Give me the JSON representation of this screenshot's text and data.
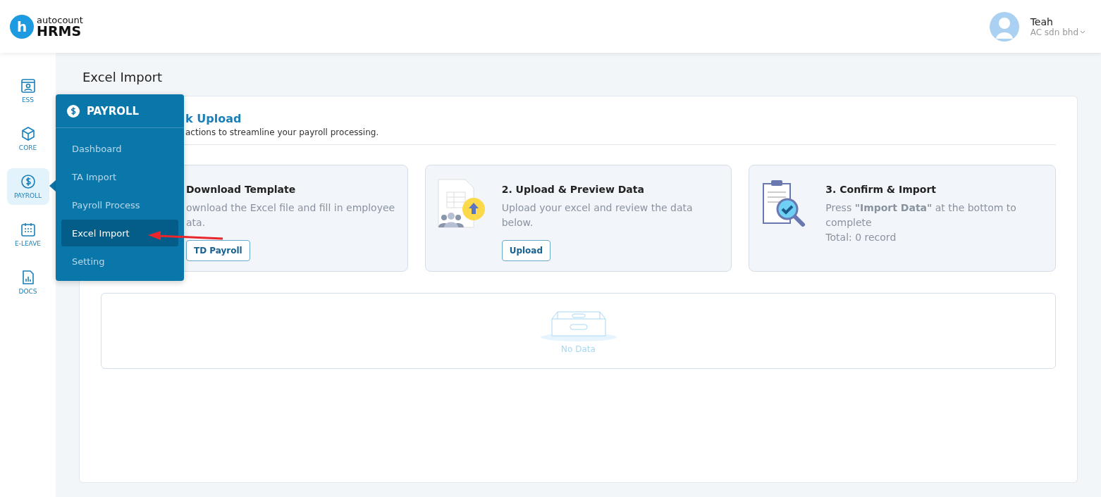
{
  "brand": {
    "logo_letter": "h",
    "name_top": "autocount",
    "name_bottom": "HRMS"
  },
  "user": {
    "name": "Teah",
    "company": "AC sdn bhd"
  },
  "sidebar": {
    "items": [
      {
        "label": "ESS",
        "kind": "ess",
        "selected": false
      },
      {
        "label": "CORE",
        "kind": "core",
        "selected": false
      },
      {
        "label": "PAYROLL",
        "kind": "payroll",
        "selected": true
      },
      {
        "label": "E-LEAVE",
        "kind": "leave",
        "selected": false
      },
      {
        "label": "DOCS",
        "kind": "docs",
        "selected": false
      }
    ]
  },
  "flyout": {
    "title": "PAYROLL",
    "items": [
      {
        "label": "Dashboard",
        "selected": false
      },
      {
        "label": "TA Import",
        "selected": false
      },
      {
        "label": "Payroll Process",
        "selected": false
      },
      {
        "label": "Excel Import",
        "selected": true
      },
      {
        "label": "Setting",
        "selected": false
      }
    ]
  },
  "page": {
    "title": "Excel Import"
  },
  "section": {
    "title": "k Upload",
    "subtitle": "actions to streamline your payroll processing."
  },
  "steps": [
    {
      "kind": "download",
      "title": "Download Template",
      "lines": [
        "ownload the Excel file and fill in employee",
        "ata."
      ],
      "button": "TD Payroll"
    },
    {
      "kind": "upload",
      "title": "2. Upload & Preview Data",
      "lines": [
        "Upload your excel and review the data below."
      ],
      "button": "Upload"
    },
    {
      "kind": "confirm",
      "title": "3. Confirm & Import",
      "lines": [
        "Press **\"Import Data\"** at the bottom to complete",
        "Total: 0 record"
      ]
    }
  ],
  "table": {
    "empty_text": "No Data"
  }
}
